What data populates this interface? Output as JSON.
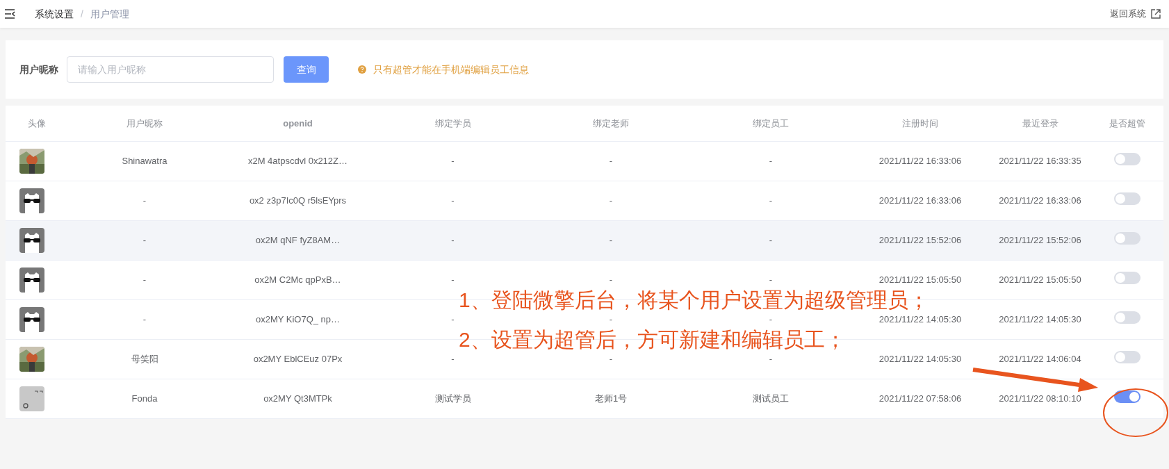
{
  "header": {
    "separator": "/",
    "breadcrumb": [
      {
        "label": "系统设置",
        "selected": false
      },
      {
        "label": "用户管理",
        "selected": true
      }
    ],
    "back_link": "返回系统"
  },
  "search": {
    "label": "用户昵称",
    "placeholder": "请输入用户昵称",
    "button": "查询",
    "notice": "只有超管才能在手机端编辑员工信息"
  },
  "table": {
    "columns": [
      "头像",
      "用户昵称",
      "openid",
      "绑定学员",
      "绑定老师",
      "绑定员工",
      "注册时间",
      "最近登录",
      "是否超管"
    ],
    "rows": [
      {
        "nickname": "Shinawatra",
        "openid": "x2M  4atpscdvl  0x212Z…",
        "student": "-",
        "teacher": "-",
        "staff": "-",
        "registered": "2021/11/22 16:33:06",
        "last_login": "2021/11/22 16:33:35",
        "super": false,
        "selected": false
      },
      {
        "avatar": {
          "kind": "cat"
        },
        "nickname": "-",
        "openid": "ox2  z3p7Ic0Q  r5lsEYprs",
        "student": "-",
        "teacher": "-",
        "staff": "-",
        "registered": "2021/11/22 16:33:06",
        "last_login": "2021/11/22 16:33:06",
        "super": false,
        "selected": false
      },
      {
        "avatar": {
          "kind": "cat"
        },
        "nickname": "-",
        "openid": "ox2M  qNF  fyZ8AM…",
        "student": "-",
        "teacher": "-",
        "staff": "-",
        "registered": "2021/11/22 15:52:06",
        "last_login": "2021/11/22 15:52:06",
        "super": false,
        "selected": true
      },
      {
        "avatar": {
          "kind": "cat"
        },
        "nickname": "-",
        "openid": "ox2M  C2Mc  qpPxB…",
        "student": "-",
        "teacher": "-",
        "staff": "-",
        "registered": "2021/11/22 15:05:50",
        "last_login": "2021/11/22 15:05:50",
        "super": false,
        "selected": false
      },
      {
        "avatar": {
          "kind": "cat"
        },
        "nickname": "-",
        "openid": "ox2MY  KiO7Q_  np…",
        "student": "-",
        "teacher": "-",
        "staff": "-",
        "registered": "2021/11/22 14:05:30",
        "last_login": "2021/11/22 14:05:30",
        "super": false,
        "selected": false
      },
      {
        "nickname": "母笑阳",
        "openid": "ox2MY  EblCEuz  07Px",
        "student": "-",
        "teacher": "-",
        "staff": "-",
        "registered": "2021/11/22 14:05:30",
        "last_login": "2021/11/22 14:06:04",
        "super": false,
        "selected": false
      },
      {
        "avatar": {
          "kind": "placeholder"
        },
        "nickname": "Fonda",
        "openid": "ox2MY  Qt3MTPk",
        "student": "测试学员",
        "teacher": "老师1号",
        "staff": "测试员工",
        "registered": "2021/11/22 07:58:06",
        "last_login": "2021/11/22 08:10:10",
        "super": true,
        "selected": false
      }
    ]
  },
  "annotations": [
    "1、登陆微擎后台，将某个用户设置为超级管理员；",
    "2、设置为超管后，方可新建和编辑员工；"
  ]
}
